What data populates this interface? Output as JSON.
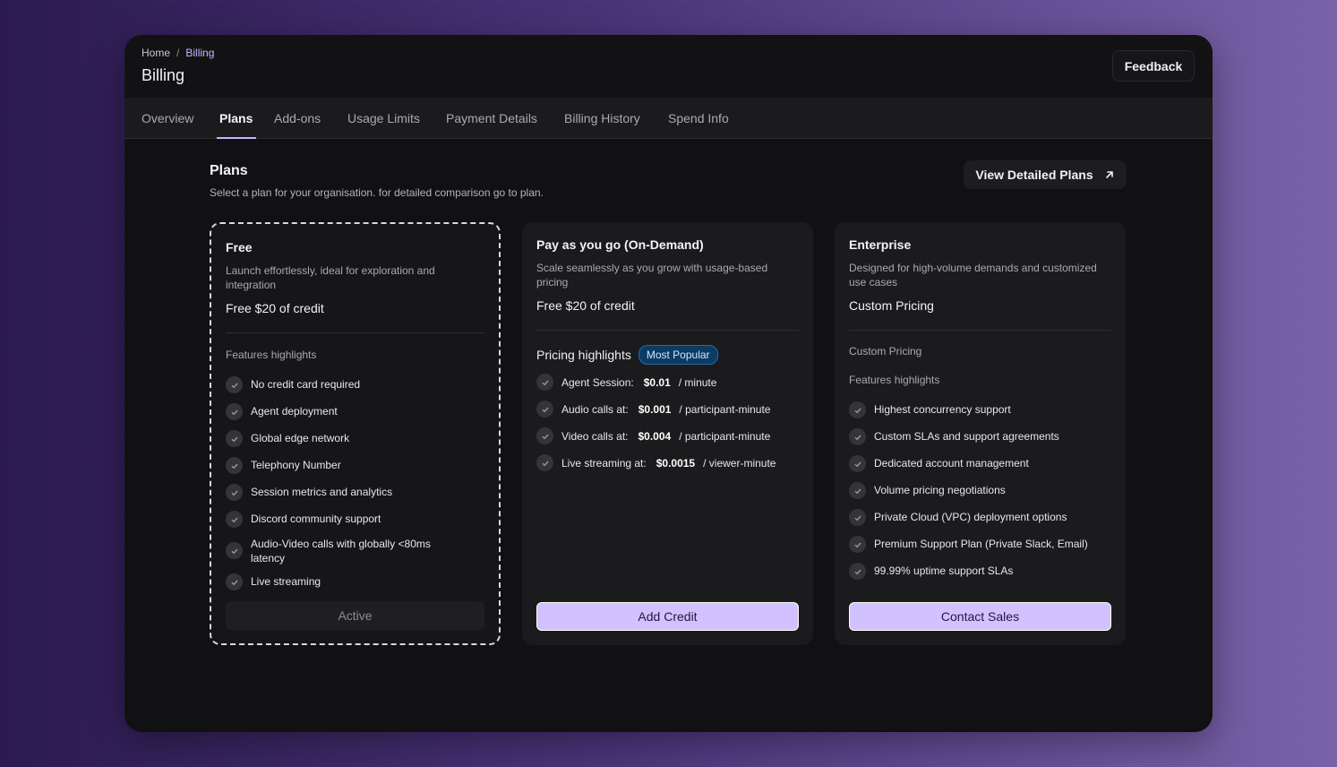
{
  "header": {
    "breadcrumb": [
      "Home",
      "Billing"
    ],
    "breadcrumb_sep": "/",
    "title": "Billing",
    "feedback_label": "Feedback"
  },
  "tabs": [
    {
      "label": "Overview",
      "active": false
    },
    {
      "label": "Plans",
      "active": true
    },
    {
      "label": "Add-ons",
      "active": false
    },
    {
      "label": "Usage Limits",
      "active": false
    },
    {
      "label": "Payment Details",
      "active": false
    },
    {
      "label": "Billing History",
      "active": false
    },
    {
      "label": "Spend Info",
      "active": false
    }
  ],
  "plans_section": {
    "title": "Plans",
    "subtitle": "Select a plan for your organisation. for detailed comparison go to plan.",
    "detailed_button": "View Detailed Plans",
    "detailed_icon": "arrow-up-right-icon"
  },
  "cards": {
    "free": {
      "title": "Free",
      "description": "Launch effortlessly, ideal for exploration and integration",
      "price": "Free $20 of credit",
      "features_label": "Features highlights",
      "features": [
        "No credit card required",
        "Agent deployment",
        "Global edge network",
        "Telephony Number",
        "Session metrics and analytics",
        "Discord community support",
        "Audio-Video calls with globally <80ms latency",
        "Live streaming"
      ],
      "button": "Active"
    },
    "payg": {
      "title": "Pay as you go (On-Demand)",
      "description": "Scale seamlessly as you grow with usage-based pricing",
      "price": "Free $20 of credit",
      "pricing_label": "Pricing highlights",
      "badge": "Most Popular",
      "pricing": [
        {
          "label": "Agent Session:",
          "value": "$0.01",
          "unit": "/ minute"
        },
        {
          "label": "Audio calls at:",
          "value": "$0.001",
          "unit": "/ participant-minute"
        },
        {
          "label": "Video calls at:",
          "value": "$0.004",
          "unit": "/ participant-minute"
        },
        {
          "label": "Live streaming at:",
          "value": "$0.0015",
          "unit": "/ viewer-minute"
        }
      ],
      "button": "Add Credit"
    },
    "enterprise": {
      "title": "Enterprise",
      "description": "Designed for high-volume demands and customized use cases",
      "price": "Custom Pricing",
      "pricing_label": "Custom Pricing",
      "features_label": "Features highlights",
      "features": [
        "Highest concurrency support",
        "Custom SLAs and support agreements",
        "Dedicated account management",
        "Volume pricing negotiations",
        "Private Cloud (VPC) deployment options",
        "Premium Support Plan (Private Slack, Email)",
        "99.99% uptime support SLAs"
      ],
      "button": "Contact Sales"
    }
  },
  "colors": {
    "accent": "#d2c1ff",
    "badge_bg": "#0c3b63"
  }
}
